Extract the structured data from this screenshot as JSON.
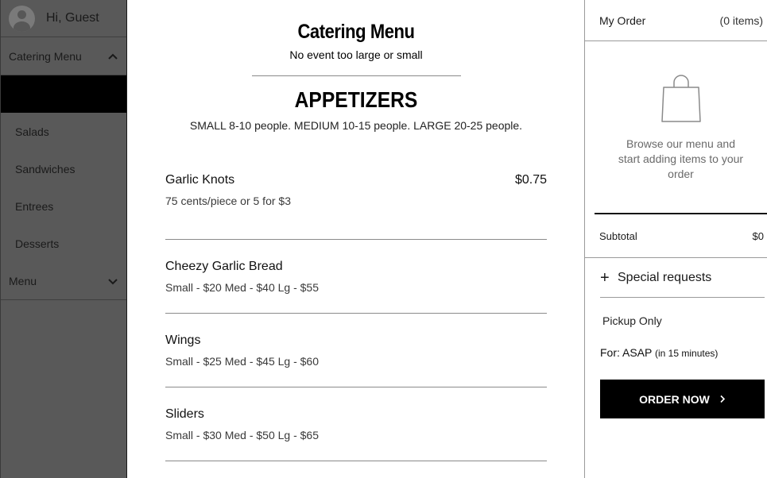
{
  "sidebar": {
    "greeting": "Hi, Guest",
    "catering_menu_label": "Catering Menu",
    "sub_items": [
      "Salads",
      "Sandwiches",
      "Entrees",
      "Desserts"
    ],
    "menu_label": "Menu"
  },
  "main": {
    "title": "Catering Menu",
    "subtitle": "No event too large or small",
    "section": {
      "title": "APPETIZERS",
      "description": "SMALL 8-10 people. MEDIUM 10-15 people. LARGE 20-25 people."
    },
    "items": [
      {
        "name": "Garlic Knots",
        "price": "$0.75",
        "description": "75 cents/piece or 5 for $3"
      },
      {
        "name": "Cheezy Garlic Bread",
        "price": "",
        "description": "Small - $20 Med - $40 Lg - $55"
      },
      {
        "name": "Wings",
        "price": "",
        "description": "Small - $25 Med - $45 Lg - $60"
      },
      {
        "name": "Sliders",
        "price": "",
        "description": "Small - $30 Med - $50 Lg - $65"
      }
    ]
  },
  "order": {
    "title": "My Order",
    "count": "(0 items)",
    "empty_message": "Browse our menu and start adding items to your order",
    "subtotal_label": "Subtotal",
    "subtotal_value": "$0",
    "special_requests": "Special requests",
    "pickup": "Pickup Only",
    "for_label": "For: ASAP",
    "for_note": "(in 15 minutes)",
    "order_button": "ORDER NOW"
  },
  "icons": {
    "avatar": "user-avatar-icon",
    "chevron_up": "chevron-up-icon",
    "chevron_down": "chevron-down-icon",
    "bag": "shopping-bag-icon",
    "plus": "plus-icon",
    "arrow": "chevron-right-icon"
  }
}
